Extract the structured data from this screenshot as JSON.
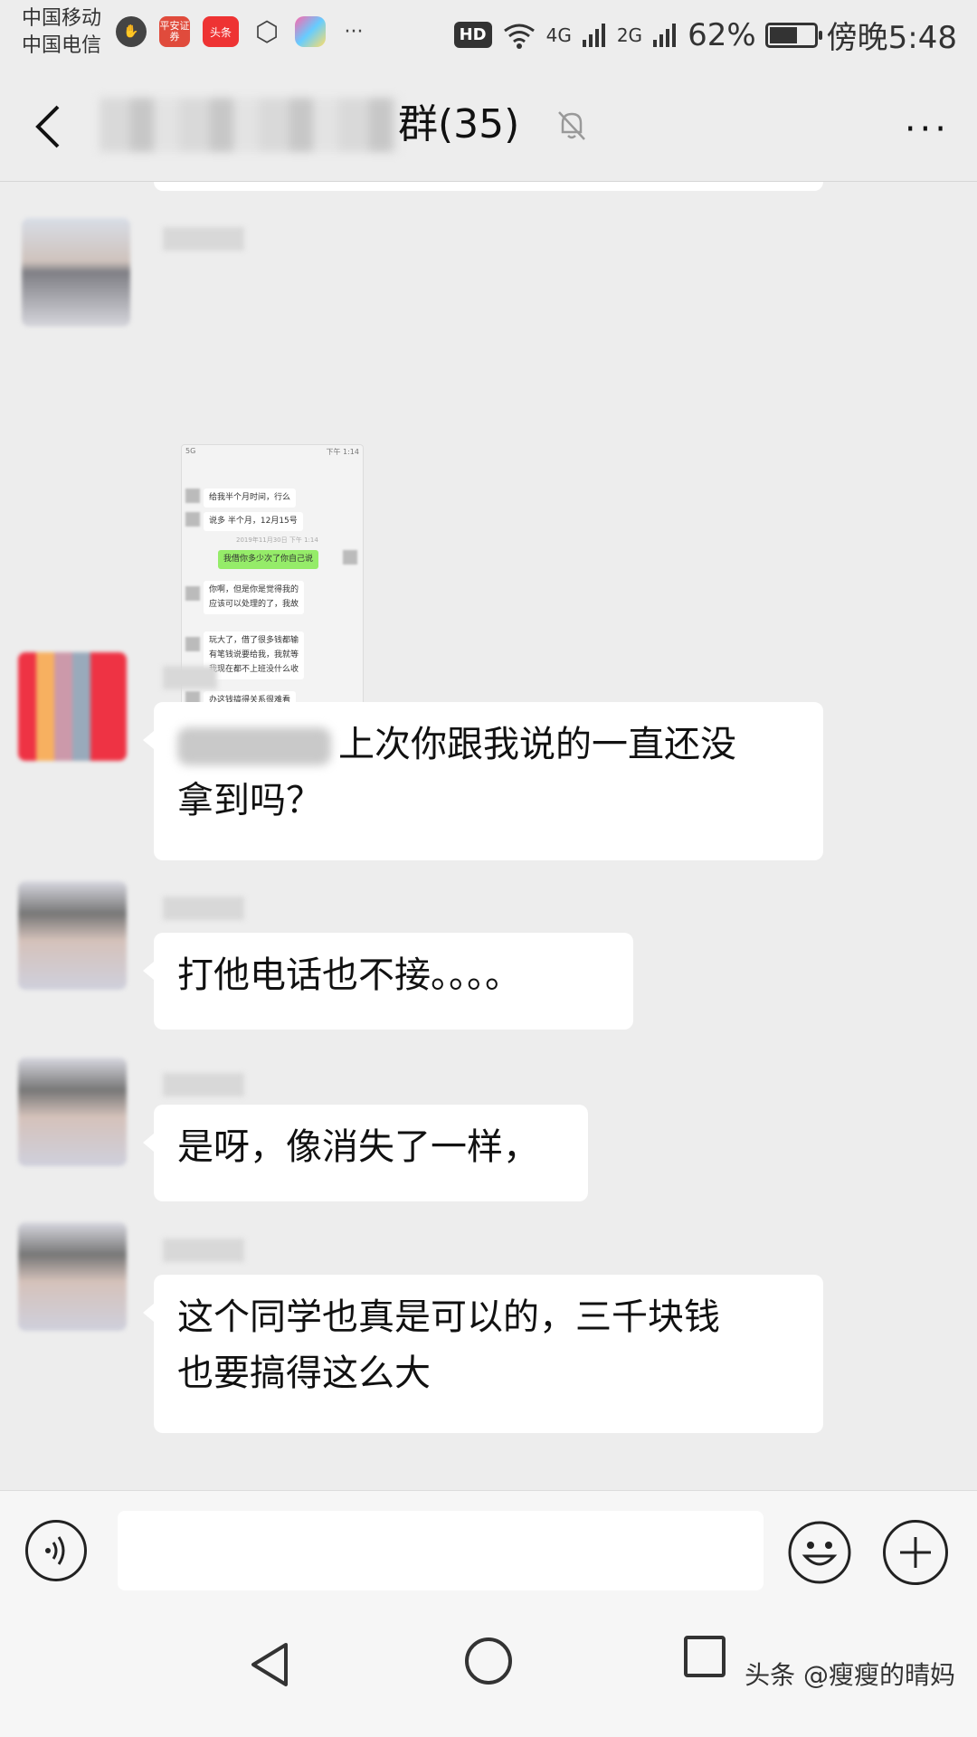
{
  "status_bar": {
    "carrier1": "中国移动",
    "carrier2": "中国电信",
    "app_icons": [
      "shield-icon",
      "pingan-zhengquan-icon",
      "toutiao-icon",
      "settings-hex-icon",
      "flower-icon",
      "more-dots-icon"
    ],
    "pingan_label": "平安证券",
    "toutiao_label": "头条",
    "notif_more": "···",
    "hd": "HD",
    "net1": "4G",
    "net2": "2G",
    "battery_percent": "62%",
    "battery_level": 0.62,
    "time": "傍晚5:48"
  },
  "title_bar": {
    "title_visible": "群(35)",
    "back_icon": "chevron-left-icon",
    "mute_icon": "bell-muted-icon",
    "more_label": "···"
  },
  "chat": {
    "screenshot": {
      "status": "下午 1:14",
      "signal": "5G",
      "lines": [
        "给我半个月时间，行么",
        "说多 半个月，12月15号",
        "我借你多少次了你自己说",
        "你啊，但是你是觉得我的",
        "应该可以处理的了，我故",
        "玩大了，借了很多钱都输",
        "有笔钱说要给我，我就等",
        "我现在都不上班没什么收",
        "办这钱搞得关系很难看"
      ],
      "timestamp": "2019年11月30日 下午 1:14"
    },
    "messages": [
      {
        "text": "上次你跟我说的一直还没拿到吗？",
        "line1": "上次你跟我说的一直还没",
        "line2": "拿到吗？"
      },
      {
        "text": "打他电话也不接。。。。"
      },
      {
        "text": "是呀，像消失了一样，"
      },
      {
        "text": "这个同学也真是可以的，三千块钱也要搞得这么大",
        "line1": "这个同学也真是可以的，三千块钱",
        "line2": "也要搞得这么大"
      }
    ]
  },
  "input_bar": {
    "voice_icon": "voice-icon",
    "input_value": "",
    "emoji_icon": "emoji-icon",
    "plus_icon": "plus-icon"
  },
  "nav_bar": {
    "back_icon": "nav-back-icon",
    "home_icon": "nav-home-icon",
    "recent_icon": "nav-recent-icon",
    "watermark": "头条 @瘦瘦的晴妈"
  }
}
